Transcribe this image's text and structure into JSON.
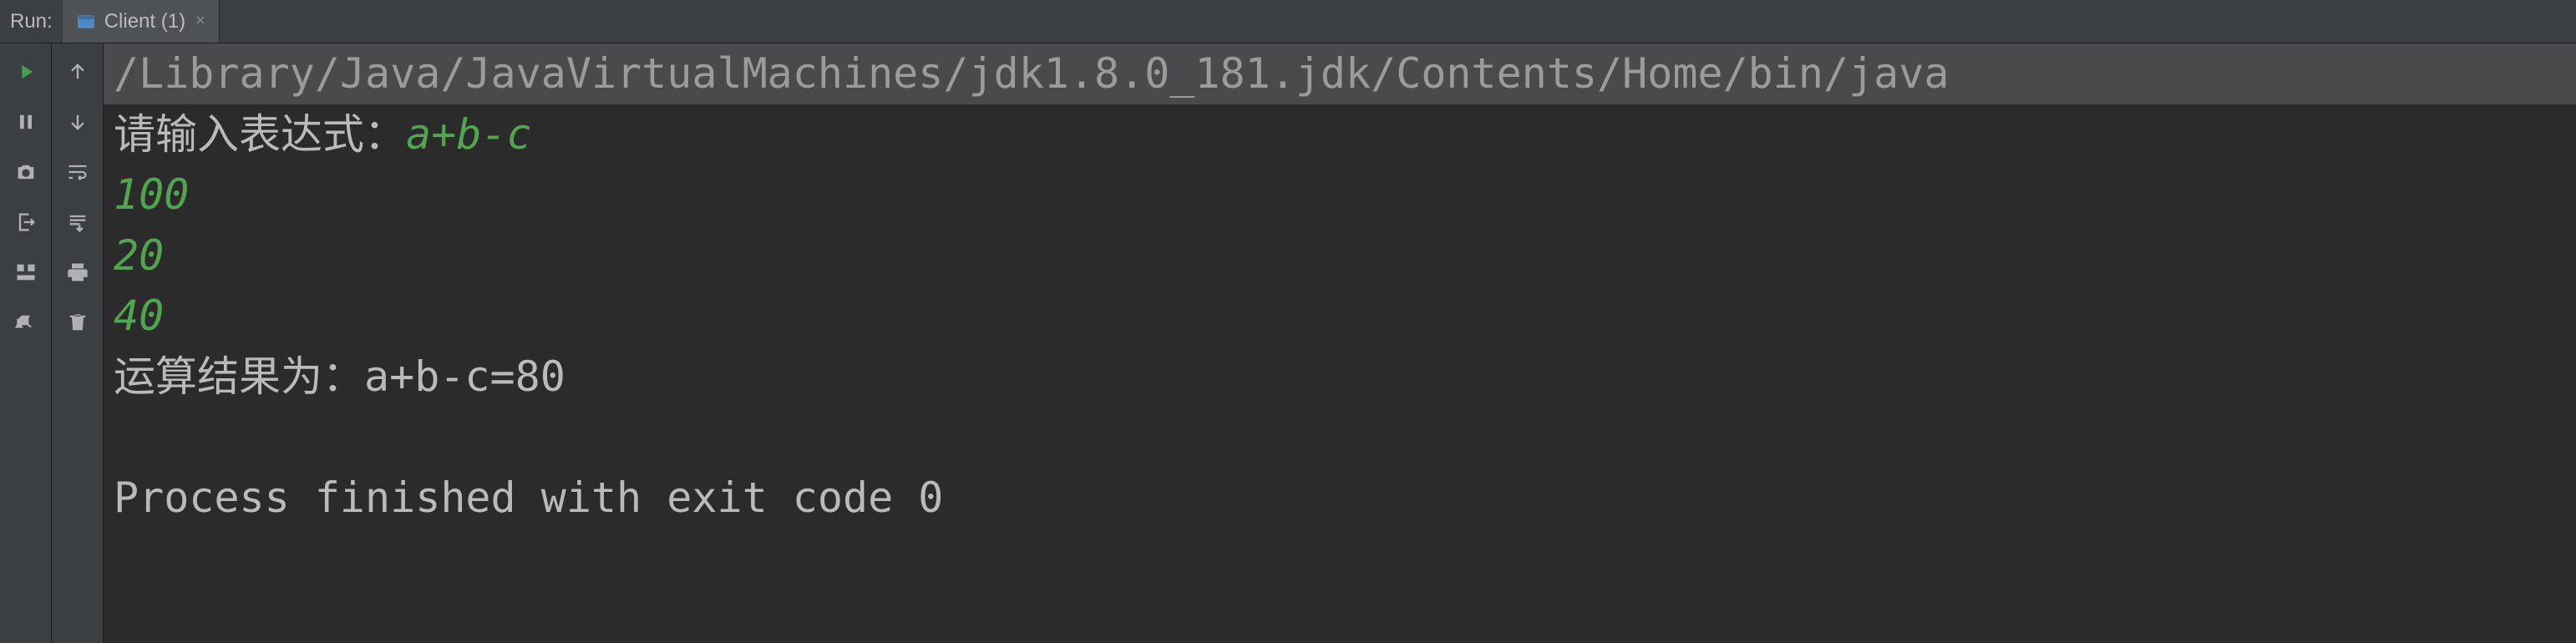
{
  "tabbar": {
    "run_label": "Run:",
    "tab_label": "Client (1)"
  },
  "console": {
    "command_line": "/Library/Java/JavaVirtualMachines/jdk1.8.0_181.jdk/Contents/Home/bin/java",
    "prompt_text": "请输入表达式：",
    "user_expression": "a+b-c",
    "input_values": [
      "100",
      "20",
      "40"
    ],
    "result_text": "运算结果为：a+b-c=80",
    "exit_text": "Process finished with exit code 0"
  }
}
